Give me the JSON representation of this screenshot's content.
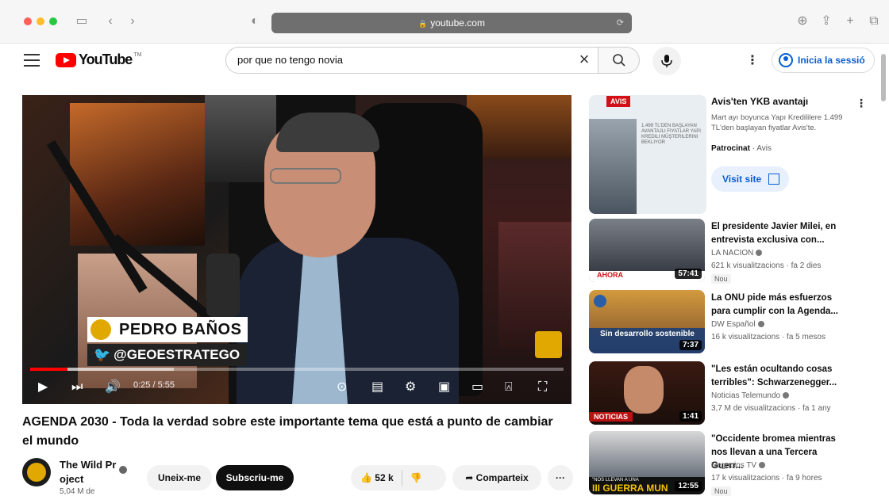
{
  "browser": {
    "address": "youtube.com"
  },
  "header": {
    "logo_text": "YouTube",
    "logo_tm": "TM",
    "search_value": "por que no tengo novia",
    "clear_label": "×",
    "signin_label": "Inicia la sessió"
  },
  "player": {
    "lower_third_name": "PEDRO BAÑOS",
    "lower_third_handle": "@GEOESTRATEGO",
    "time_current": "0:25",
    "time_total": "5:55",
    "time_display": "0:25 / 5:55",
    "progress_fraction": 0.07
  },
  "video": {
    "title": "AGENDA 2030 - Toda la verdad sobre este importante tema que está a punto de cambiar el mundo",
    "channel_name": "The Wild Pr oject",
    "subscribers": "5,04 M de",
    "join_label": "Uneix-me",
    "subscribe_label": "Subscriu-me",
    "likes": "52 k",
    "share_label": "Comparteix",
    "more_label": "···"
  },
  "ad": {
    "badge": "AVIS",
    "image_text": "1.499 TL'den başlayan avantajlı fiyatlar Yapı Kredili müşterilerini bekliyor",
    "title": "Avis'ten YKB avantajı",
    "description": "Mart ayı boyunca Yapı Kredililere 1.499 TL'den başlayan fiyatlar Avis'te.",
    "sponsor_label": "Patrocinat",
    "sponsor_name": "· Avis",
    "visit_label": "Visit site"
  },
  "recommendations": [
    {
      "title": "El presidente Javier Milei, en entrevista exclusiva con...",
      "channel": "LA NACION",
      "meta": "621 k visualitzacions · fa 2 dies",
      "badge": "Nou",
      "duration": "57:41",
      "thumb_text": "AHORA"
    },
    {
      "title": "La ONU pide más esfuerzos para cumplir con la Agenda...",
      "channel": "DW Español",
      "meta": "16 k visualitzacions · fa 5 mesos",
      "duration": "7:37",
      "thumb_text": "Sin desarrollo sostenible"
    },
    {
      "title": "\"Les están ocultando cosas terribles\": Schwarzenegger...",
      "channel": "Noticias Telemundo",
      "meta": "3,7 M de visualitzacions · fa 1 any",
      "duration": "1:41",
      "thumb_text": "NOTICIAS"
    },
    {
      "title": "\"Occidente bromea mientras nos llevan a una Tercera Guerr...",
      "channel": "Negocios TV",
      "meta": "17 k visualitzacions · fa 9 hores",
      "badge": "Nou",
      "duration": "12:55",
      "thumb_text_small": "\"NOS LLEVAN A UNA",
      "thumb_text": "III GUERRA MUN"
    }
  ],
  "colors": {
    "brand_red": "#ff0000",
    "link_blue": "#065fd4",
    "lower_third_gold": "#e0a800"
  }
}
